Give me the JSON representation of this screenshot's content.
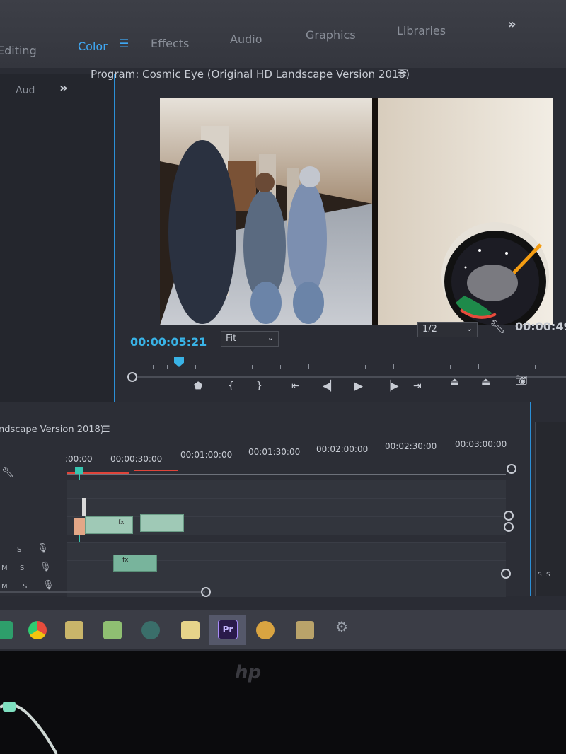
{
  "workspaces": [
    "Editing",
    "Color",
    "Effects",
    "Audio",
    "Graphics",
    "Libraries"
  ],
  "workspace_active": "Color",
  "left_panel": {
    "tab": "Aud"
  },
  "program": {
    "title": "Program: Cosmic Eye (Original HD Landscape Version 2018)",
    "timecode": "00:00:05:21",
    "fit": "Fit",
    "resolution": "1/2",
    "duration": "00:00:49"
  },
  "timeline": {
    "title": "ndscape Version 2018)",
    "times": [
      ":00:00",
      "00:00:30:00",
      "00:01:00:00",
      "00:01:30:00",
      "00:02:00:00",
      "00:02:30:00",
      "00:03:00:00"
    ],
    "track_labels": {
      "solo": "S",
      "mute": "M"
    },
    "clip_fx": "fx"
  },
  "taskbar": {
    "premiere_label": "Pr"
  },
  "monitor": {
    "brand": "hp"
  },
  "colors": {
    "accent": "#39b3e6",
    "panel_border": "#2b8fd6",
    "video_clip": "#9fc9b6",
    "audio_clip": "#78b49c"
  }
}
